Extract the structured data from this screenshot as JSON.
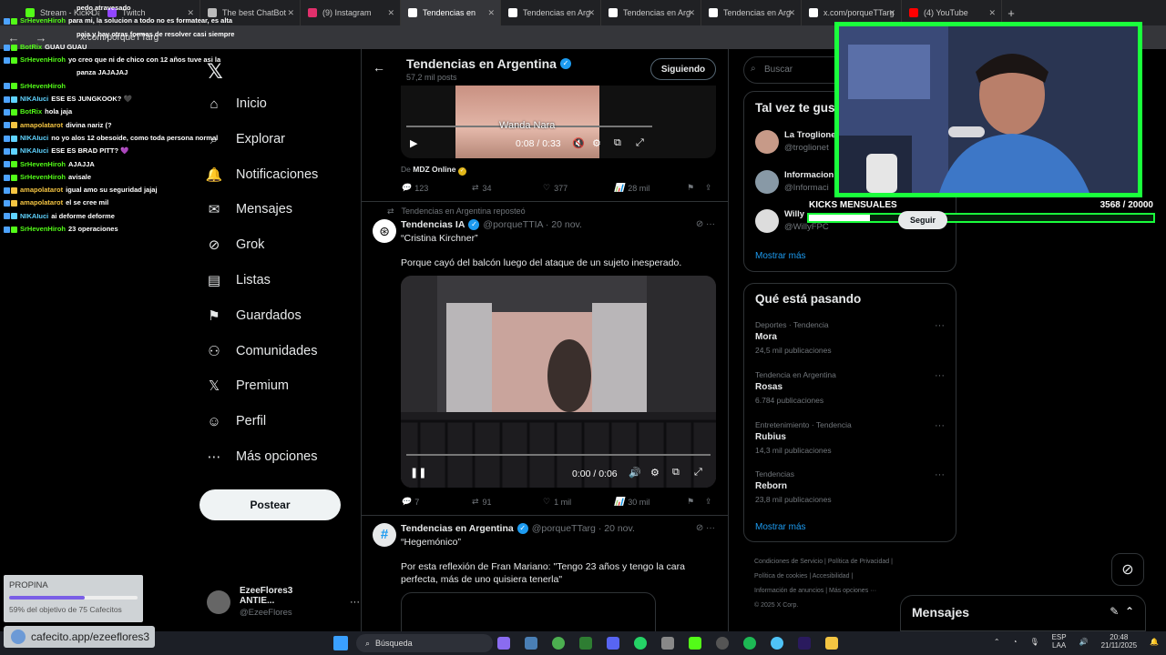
{
  "browser": {
    "tabs": [
      {
        "label": "Stream - Kick Da",
        "icon_color": "#53fc18"
      },
      {
        "label": "Twitch",
        "icon_color": "#9146ff"
      },
      {
        "label": "The best ChatBot",
        "icon_color": "#bbbbbb"
      },
      {
        "label": "(9) Instagram",
        "icon_color": "#e1306c"
      },
      {
        "label": "Tendencias en",
        "icon_color": "#ffffff"
      },
      {
        "label": "Tendencias en Arg",
        "icon_color": "#ffffff"
      },
      {
        "label": "Tendencias en Arg",
        "icon_color": "#ffffff"
      },
      {
        "label": "Tendencias en Arg",
        "icon_color": "#ffffff"
      },
      {
        "label": "x.com/porqueTTarg",
        "icon_color": "#ffffff"
      },
      {
        "label": "(4) YouTube",
        "icon_color": "#ff0000"
      }
    ],
    "new_tab": "+",
    "url": "x.com/porqueTTarg"
  },
  "chat": [
    {
      "user": "",
      "text": "pedo atravesado",
      "color": "#ffffff"
    },
    {
      "user": "SrHevenHiroh",
      "text": "para mi, la solucion a todo no es formatear, es alta",
      "color": "#53fc18"
    },
    {
      "user": "",
      "text": "paja y hay otras formas de resolver casi siempre",
      "color": "#ffffff"
    },
    {
      "user": "BotRix",
      "text": "GUAU GUAU",
      "color": "#53fc18"
    },
    {
      "user": "SrHevenHiroh",
      "text": "yo creo que ni de chico con 12 años tuve asi la",
      "color": "#53fc18"
    },
    {
      "user": "",
      "text": "panza JAJAJAJ",
      "color": "#ffffff"
    },
    {
      "user": "SrHevenHiroh",
      "text": "",
      "color": "#53fc18"
    },
    {
      "user": "NIKAIuci",
      "text": "ESE ES JUNGKOOK? 🖤",
      "color": "#5fd3ff"
    },
    {
      "user": "BotRix",
      "text": "hola jaja",
      "color": "#53fc18"
    },
    {
      "user": "amapolatarot",
      "text": "divina nariz (?",
      "color": "#f5c542"
    },
    {
      "user": "NIKAIuci",
      "text": "no yo alos 12 obesoide, como toda persona normal",
      "color": "#5fd3ff"
    },
    {
      "user": "NIKAIuci",
      "text": "ESE ES BRAD PITT? 💜",
      "color": "#5fd3ff"
    },
    {
      "user": "SrHevenHiroh",
      "text": "AJAJJA",
      "color": "#53fc18"
    },
    {
      "user": "SrHevenHiroh",
      "text": "avisale",
      "color": "#53fc18"
    },
    {
      "user": "amapolatarot",
      "text": "igual amo su seguridad jajaj",
      "color": "#f5c542"
    },
    {
      "user": "amapolatarot",
      "text": "el se cree mil",
      "color": "#f5c542"
    },
    {
      "user": "NIKAIuci",
      "text": "ai deforme deforme",
      "color": "#5fd3ff"
    },
    {
      "user": "SrHevenHiroh",
      "text": "23 operaciones",
      "color": "#53fc18"
    }
  ],
  "sidebar": {
    "items": [
      {
        "label": "Inicio",
        "icon": "⌂"
      },
      {
        "label": "Explorar",
        "icon": "⌕"
      },
      {
        "label": "Notificaciones",
        "icon": "🔔"
      },
      {
        "label": "Mensajes",
        "icon": "✉"
      },
      {
        "label": "Grok",
        "icon": "⊘"
      },
      {
        "label": "Listas",
        "icon": "▤"
      },
      {
        "label": "Guardados",
        "icon": "⚑"
      },
      {
        "label": "Comunidades",
        "icon": "⚇"
      },
      {
        "label": "Premium",
        "icon": "𝕏"
      },
      {
        "label": "Perfil",
        "icon": "☺"
      },
      {
        "label": "Más opciones",
        "icon": "⋯"
      }
    ],
    "post_label": "Postear",
    "profile_name": "EzeeFlores3 ANTIE...",
    "profile_handle": "@EzeeFlores",
    "profile_more": "···"
  },
  "header": {
    "title": "Tendencias en Argentina",
    "subtitle": "57,2 mil posts",
    "follow_label": "Siguiendo"
  },
  "tweet1": {
    "caption": "Wanda Nara",
    "time": "0:08 / 0:33",
    "source_prefix": "De",
    "source": "MDZ Online",
    "replies": "123",
    "reposts": "34",
    "likes": "377",
    "views": "28 mil"
  },
  "tweet2": {
    "repost_note": "Tendencias en Argentina reposteó",
    "name": "Tendencias IA",
    "handle": "@porqueTTIA · 20 nov.",
    "quote": "“Cristina Kirchner”",
    "text": "Porque cayó del balcón luego del ataque de un sujeto inesperado.",
    "time": "0:00 / 0:06",
    "replies": "7",
    "reposts": "91",
    "likes": "1 mil",
    "views": "30 mil"
  },
  "tweet3": {
    "name": "Tendencias en Argentina",
    "handle": "@porqueTTarg · 20 nov.",
    "quote": "“Hegemónico”",
    "text": "Por esta reflexión de Fran Mariano: \"Tengo 23 años y tengo la cara perfecta, más de uno quisiera tenerla\""
  },
  "right": {
    "search_placeholder": "Buscar",
    "suggest_title": "Tal vez te gust",
    "suggestions": [
      {
        "name": "La Troglione",
        "handle": "@troglionet"
      },
      {
        "name": "Informacion",
        "handle": "@Informaci"
      },
      {
        "name": "Willy",
        "handle": "@WillyFPC"
      }
    ],
    "follow_btn": "Seguir",
    "show_more": "Mostrar más",
    "happening_title": "Qué está pasando",
    "trends": [
      {
        "meta": "Deportes · Tendencia",
        "name": "Mora",
        "count": "24,5 mil publicaciones"
      },
      {
        "meta": "Tendencia en Argentina",
        "name": "Rosas",
        "count": "6.784 publicaciones"
      },
      {
        "meta": "Entretenimiento · Tendencia",
        "name": "Rubius",
        "count": "14,3 mil publicaciones"
      },
      {
        "meta": "Tendencias",
        "name": "Reborn",
        "count": "23,8 mil publicaciones"
      }
    ],
    "footer": [
      "Condiciones de Servicio",
      "Política de Privacidad",
      "Política de cookies",
      "Accesibilidad",
      "Información de anuncios",
      "Más opciones ···",
      "© 2025 X Corp."
    ]
  },
  "overlay": {
    "kicks_label": "KICKS MENSUALES",
    "kicks_value": "3568  / 20000",
    "kicks_fraction": 0.1784,
    "propina_title": "PROPINA",
    "propina_sub": "59% del objetivo de 75 Cafecitos",
    "propina_fraction": 0.59,
    "cafecito": "cafecito.app/ezeeflores3"
  },
  "messages_label": "Mensajes",
  "taskbar": {
    "search": "Búsqueda",
    "lang1": "ESP",
    "lang2": "LAA",
    "time": "20:48",
    "date": "21/11/2025"
  },
  "colors": {
    "accent": "#1d9bf0",
    "kick_green": "#1aff3c"
  }
}
